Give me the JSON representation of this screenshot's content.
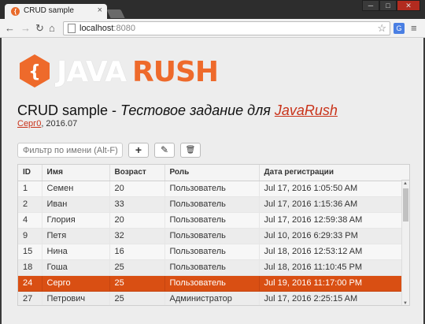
{
  "tab": {
    "title": "CRUD sample",
    "close": "×"
  },
  "window_buttons": [
    "─",
    "□",
    "✕"
  ],
  "toolbar": {
    "url_host": "localhost",
    "url_port": ":8080"
  },
  "page": {
    "logo_java": "JAVA",
    "logo_rush": "RUSH",
    "heading_prefix": "CRUD sample - ",
    "heading_italic": "Тестовое задание для ",
    "heading_link": "JavaRush",
    "author_link": "Серг0",
    "author_sep": ",",
    "date": " 2016.07",
    "filter_placeholder": "Фильтр по имени (Alt-F)"
  },
  "buttons": {
    "add": "+",
    "edit": "✎",
    "delete": "🗑"
  },
  "table": {
    "columns": [
      "ID",
      "Имя",
      "Возраст",
      "Роль",
      "Дата регистрации"
    ],
    "rows": [
      [
        "1",
        "Семен",
        "20",
        "Пользователь",
        "Jul 17, 2016 1:05:50 AM"
      ],
      [
        "2",
        "Иван",
        "33",
        "Пользователь",
        "Jul 17, 2016 1:15:36 AM"
      ],
      [
        "4",
        "Глория",
        "20",
        "Пользователь",
        "Jul 17, 2016 12:59:38 AM"
      ],
      [
        "9",
        "Петя",
        "32",
        "Пользователь",
        "Jul 10, 2016 6:29:33 PM"
      ],
      [
        "15",
        "Нина",
        "16",
        "Пользователь",
        "Jul 18, 2016 12:53:12 AM"
      ],
      [
        "18",
        "Гоша",
        "25",
        "Пользователь",
        "Jul 18, 2016 11:10:45 PM"
      ],
      [
        "24",
        "Серго",
        "25",
        "Пользователь",
        "Jul 19, 2016 11:17:00 PM"
      ],
      [
        "27",
        "Петрович",
        "25",
        "Администратор",
        "Jul 17, 2016 2:25:15 AM"
      ]
    ],
    "selected_index": 6
  },
  "colors": {
    "accent": "#d94f13",
    "link": "#c9331a",
    "brand": "#ee6a2b"
  }
}
